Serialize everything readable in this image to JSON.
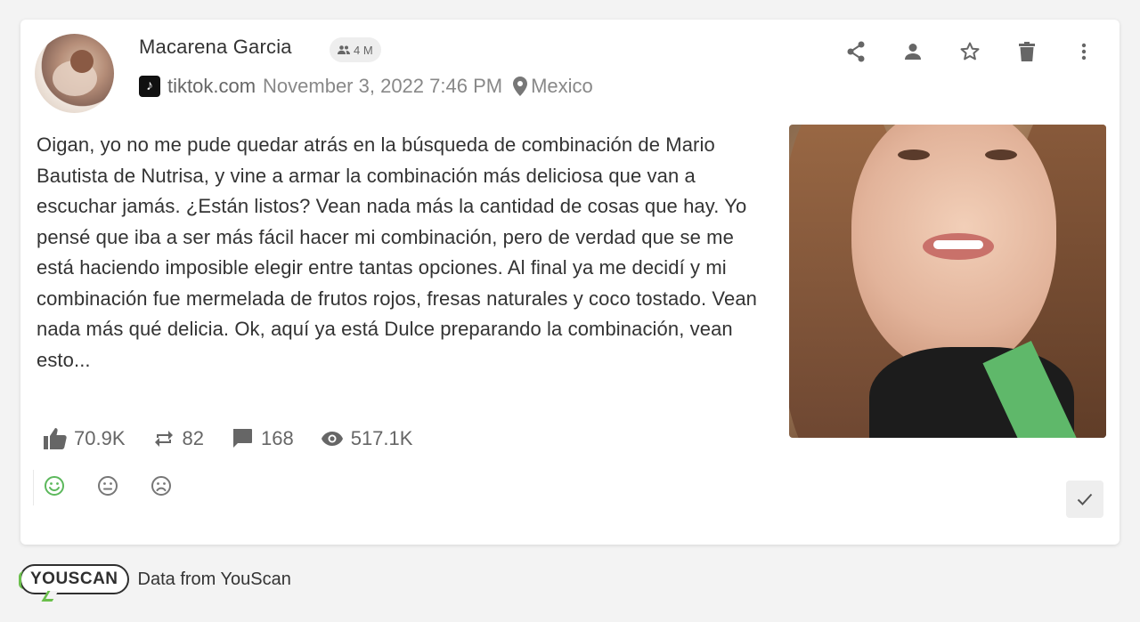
{
  "post": {
    "author": "Macarena Garcia",
    "followers": "4 M",
    "source": "tiktok.com",
    "date": "November 3, 2022 7:46 PM",
    "location": "Mexico",
    "text": "Oigan, yo no me pude quedar atrás en la búsqueda de combinación de Mario Bautista de Nutrisa, y vine a armar la combinación más deliciosa que van a escuchar jamás. ¿Están listos? Vean nada más la cantidad de cosas que hay. Yo pensé que iba a ser más fácil hacer mi combinación, pero de verdad que se me está haciendo imposible elegir entre tantas opciones. Al final ya me decidí y mi combinación fue mermelada de frutos rojos, fresas naturales y coco tostado. Vean nada más qué delicia. Ok, aquí ya está Dulce preparando la combinación, vean esto...",
    "source_icon": "tiktok-icon",
    "location_icon": "map-pin-icon"
  },
  "actions": [
    "share-icon",
    "person-icon",
    "star-icon",
    "trash-icon",
    "more-vertical-icon"
  ],
  "stats": {
    "likes": "70.9K",
    "shares": "82",
    "comments": "168",
    "views": "517.1K"
  },
  "sentiment": {
    "options": [
      "positive",
      "neutral",
      "negative"
    ],
    "selected": "positive",
    "colors": {
      "positive": "#5cb85c",
      "neutral": "#777777",
      "negative": "#777777"
    }
  },
  "footer": {
    "logo": "YOUSCAN",
    "text": "Data from YouScan",
    "accent": "#6abf4b"
  }
}
